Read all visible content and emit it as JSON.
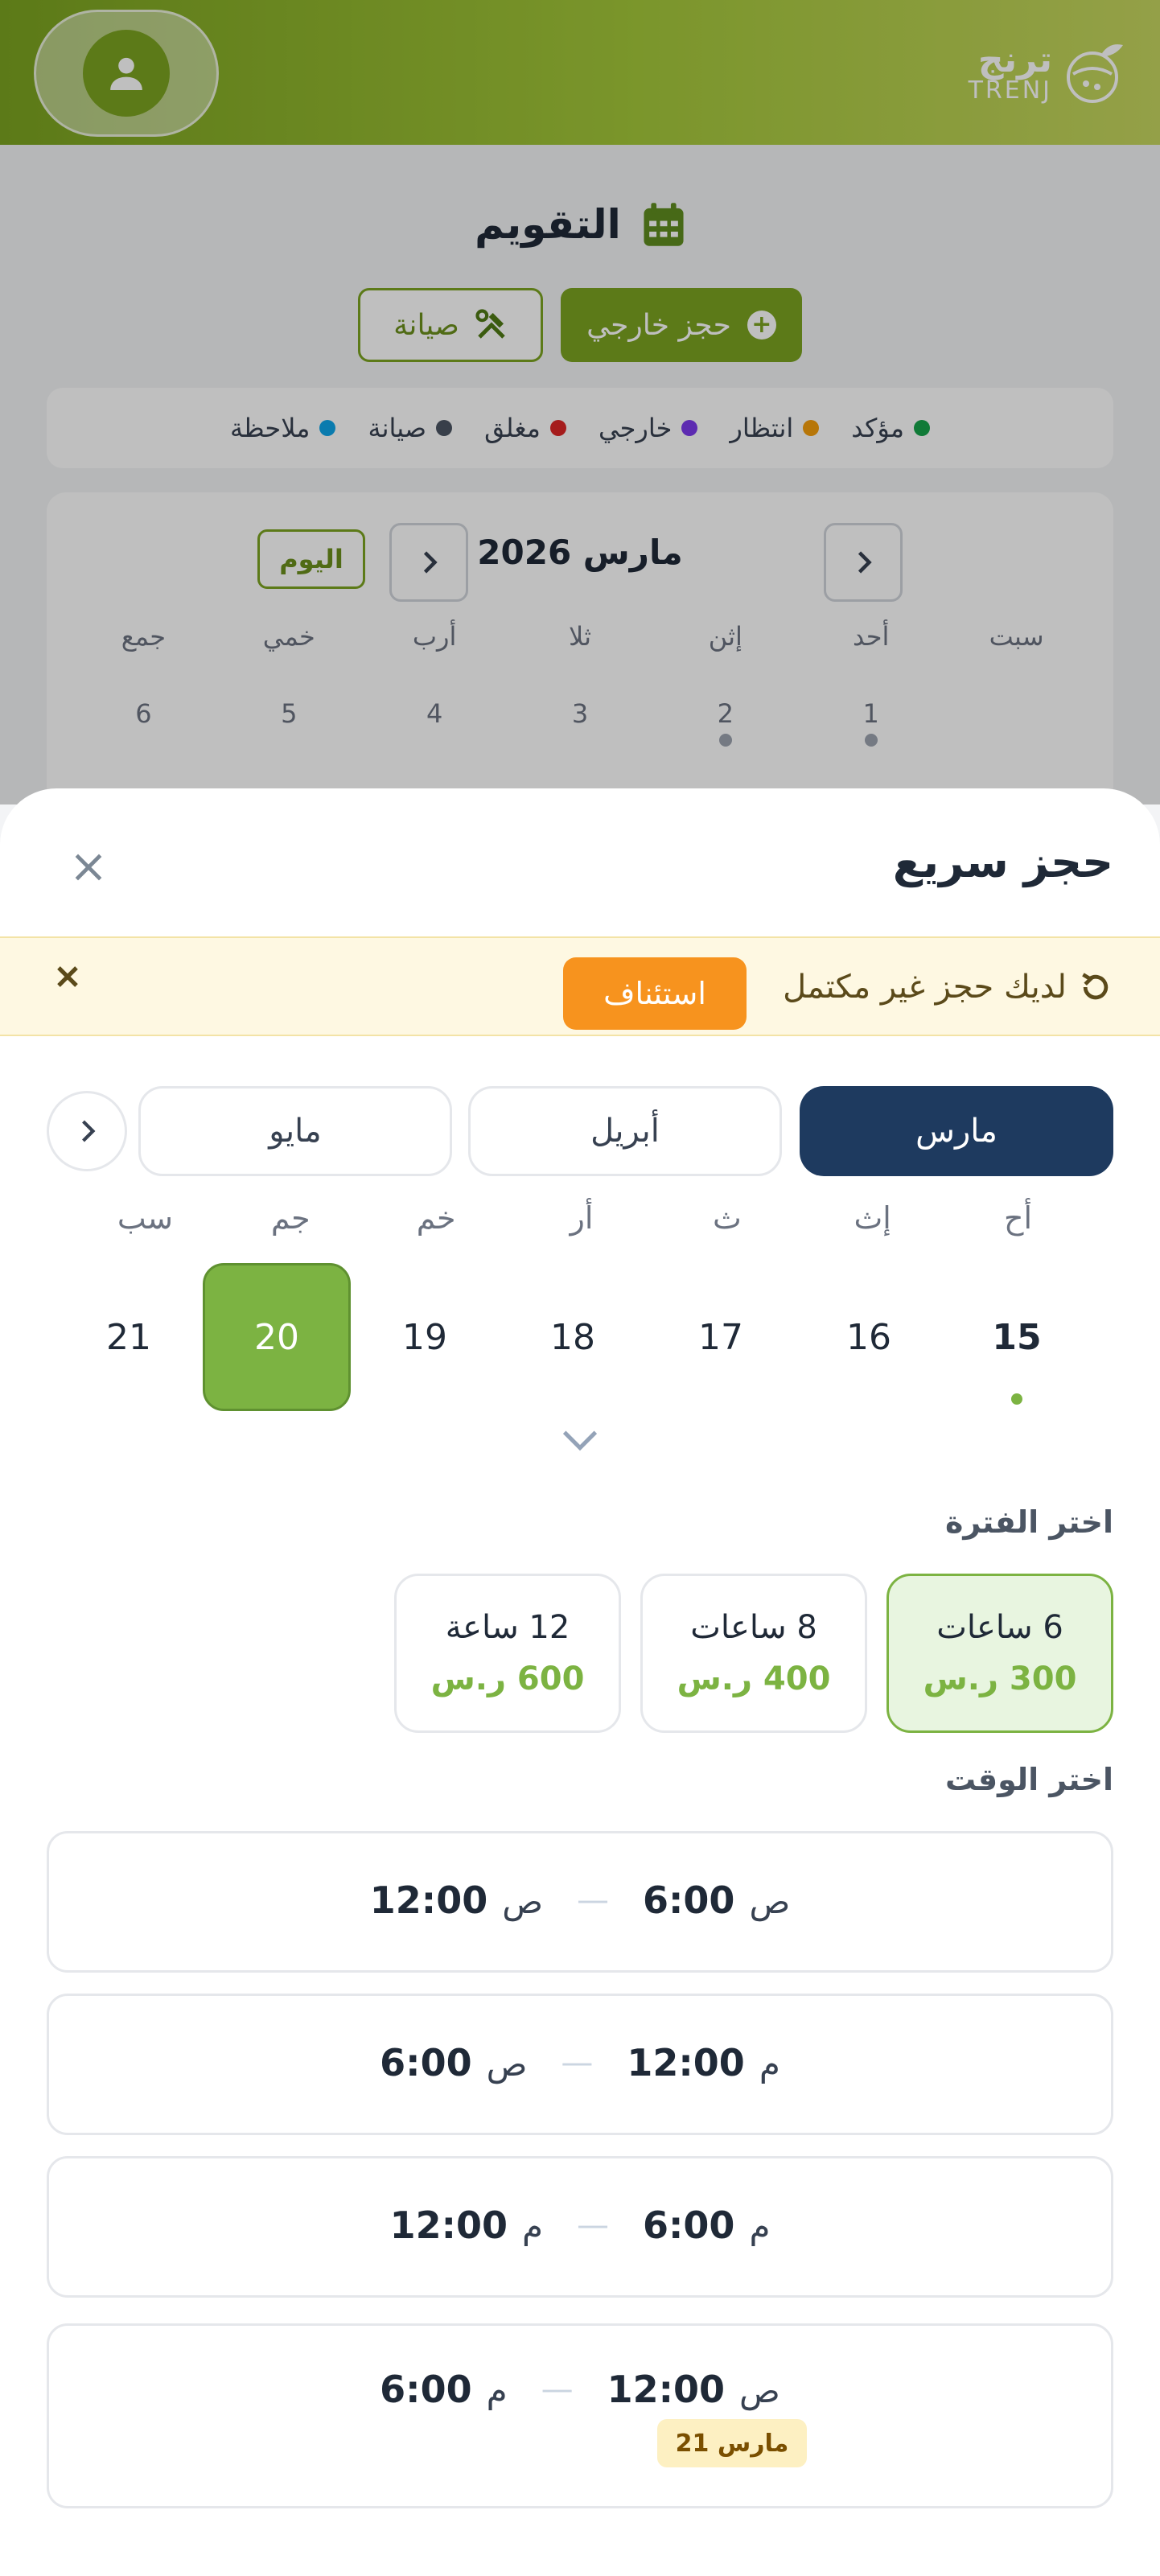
{
  "header": {
    "brand_ar": "ترنج",
    "brand_en": "TRENJ"
  },
  "calendar_page": {
    "title": "التقويم",
    "external_booking_label": "حجز خارجي",
    "maintenance_label": "صيانة",
    "legend": [
      {
        "label": "مؤكد",
        "color": "#16a34a"
      },
      {
        "label": "انتظار",
        "color": "#f59e0b"
      },
      {
        "label": "خارجي",
        "color": "#7c3aed"
      },
      {
        "label": "مغلق",
        "color": "#dc2626"
      },
      {
        "label": "صيانة",
        "color": "#4b5563"
      },
      {
        "label": "ملاحظة",
        "color": "#0ea5e9"
      }
    ],
    "month_label": "مارس 2026",
    "today_label": "اليوم",
    "weekdays": [
      "سبت",
      "أحد",
      "إثن",
      "ثلا",
      "أرب",
      "خمي",
      "جمع"
    ],
    "first_row_days": [
      "",
      "1",
      "2",
      "3",
      "4",
      "5",
      "6"
    ]
  },
  "sheet": {
    "title": "حجز سريع",
    "resume_banner": {
      "text": "لديك حجز غير مكتمل",
      "button_label": "استئناف"
    },
    "months": [
      {
        "label": "مارس",
        "active": true
      },
      {
        "label": "أبريل",
        "active": false
      },
      {
        "label": "مايو",
        "active": false
      }
    ],
    "week_headers": [
      "أح",
      "إث",
      "ث",
      "أر",
      "خم",
      "جم",
      "سب"
    ],
    "days": [
      {
        "label": "15",
        "today": true,
        "dot": true
      },
      {
        "label": "16"
      },
      {
        "label": "17"
      },
      {
        "label": "18"
      },
      {
        "label": "19"
      },
      {
        "label": "20",
        "selected": true
      },
      {
        "label": "21"
      }
    ],
    "period_label": "اختر الفترة",
    "durations": [
      {
        "label": "6 ساعات",
        "price": "300 ر.س",
        "selected": true
      },
      {
        "label": "8 ساعات",
        "price": "400 ر.س"
      },
      {
        "label": "12 ساعة",
        "price": "600 ر.س"
      }
    ],
    "time_label": "اختر الوقت",
    "slots": [
      {
        "start_period": "ص",
        "start": "6:00",
        "end_period": "ص",
        "end": "12:00"
      },
      {
        "start_period": "م",
        "start": "12:00",
        "end_period": "ص",
        "end": "6:00"
      },
      {
        "start_period": "م",
        "start": "6:00",
        "end_period": "م",
        "end": "12:00"
      },
      {
        "start_period": "ص",
        "start": "12:00",
        "end_period": "م",
        "end": "6:00",
        "badge": "21 مارس"
      }
    ]
  },
  "colors": {
    "brand_green": "#7ba320",
    "accent_green": "#7cb342",
    "navy": "#1e3a5f",
    "orange": "#f7931e"
  }
}
